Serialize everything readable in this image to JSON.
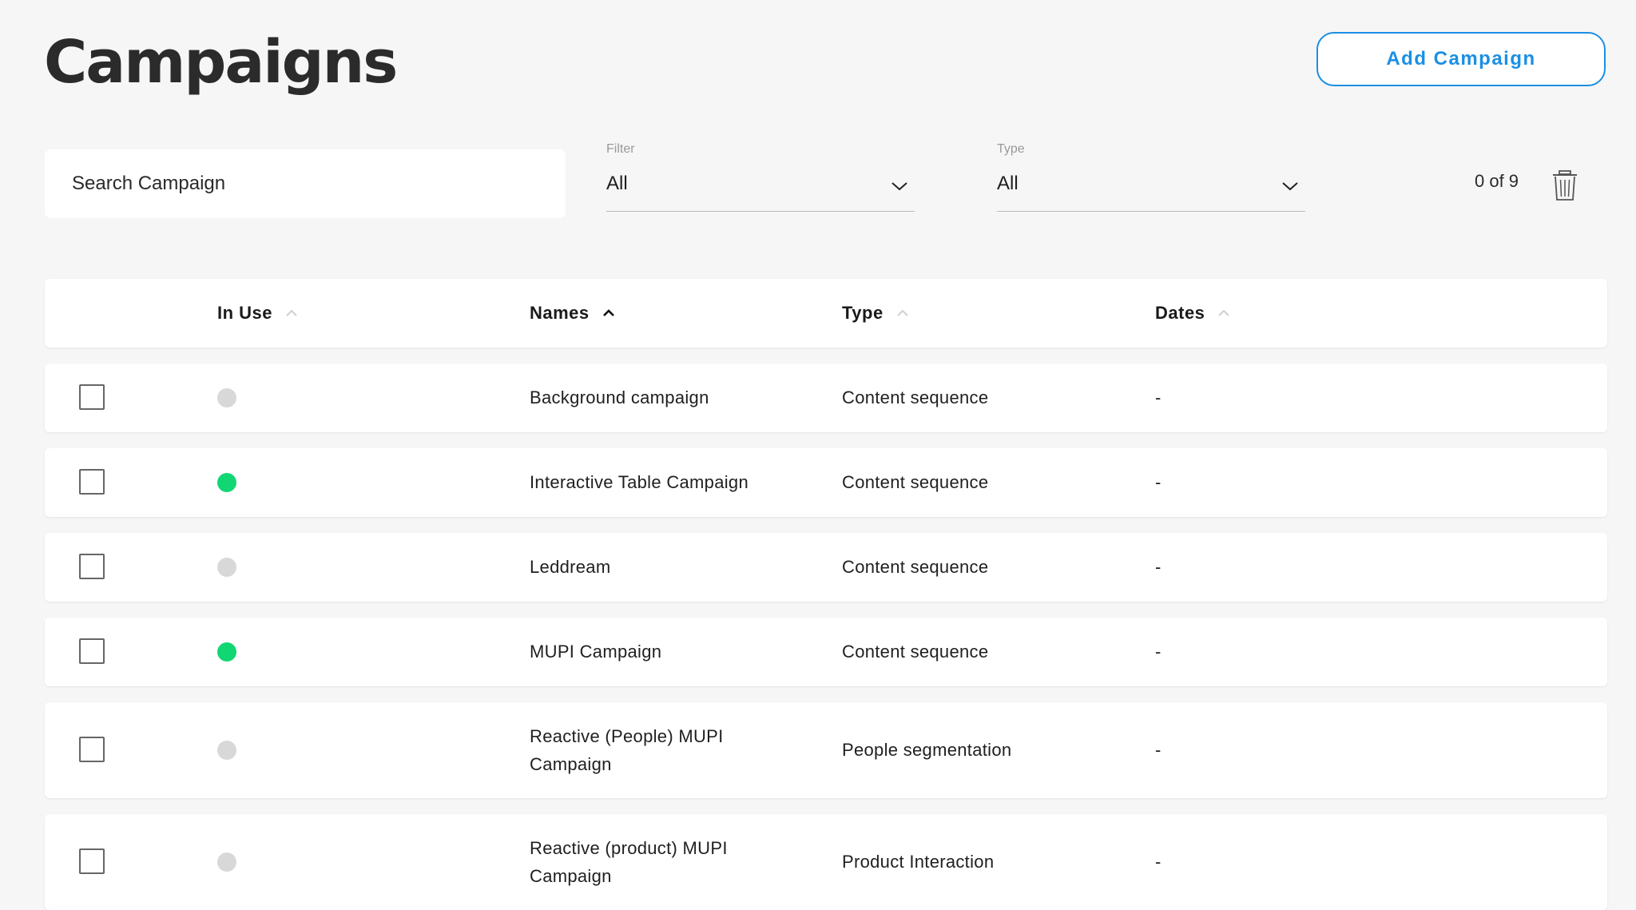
{
  "page": {
    "title": "Campaigns"
  },
  "actions": {
    "add_label": "Add Campaign"
  },
  "search": {
    "placeholder": "Search Campaign",
    "value": ""
  },
  "filter": {
    "label": "Filter",
    "value": "All"
  },
  "type_filter": {
    "label": "Type",
    "value": "All"
  },
  "selection": {
    "count_text": "0 of 9"
  },
  "columns": [
    "In Use",
    "Names",
    "Type",
    "Dates"
  ],
  "colors": {
    "accent": "#1a8fe3",
    "active": "#12d673",
    "inactive": "#d8d8d8"
  },
  "rows": [
    {
      "in_use": false,
      "name": "Background campaign",
      "type": "Content sequence",
      "dates": "-"
    },
    {
      "in_use": true,
      "name": "Interactive Table Campaign",
      "type": "Content sequence",
      "dates": "-"
    },
    {
      "in_use": false,
      "name": "Leddream",
      "type": "Content sequence",
      "dates": "-"
    },
    {
      "in_use": true,
      "name": "MUPI Campaign",
      "type": "Content sequence",
      "dates": "-"
    },
    {
      "in_use": false,
      "name_line1": "Reactive (People) MUPI",
      "name_line2": "Campaign",
      "type": "People segmentation",
      "dates": "-"
    },
    {
      "in_use": false,
      "name_line1": "Reactive (product) MUPI",
      "name_line2": "Campaign",
      "type": "Product Interaction",
      "dates": "-"
    }
  ]
}
